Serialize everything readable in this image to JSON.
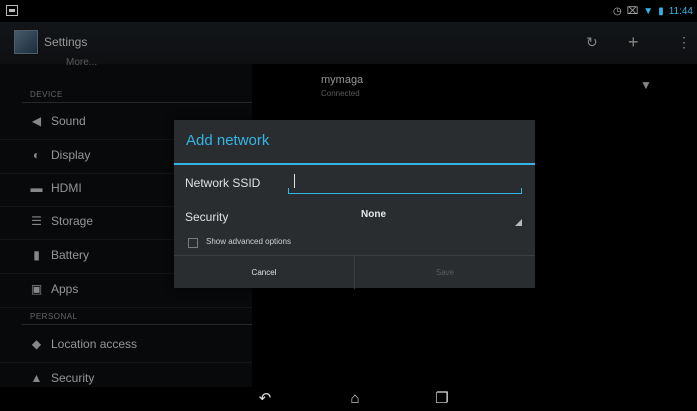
{
  "status_bar": {
    "time": "11:44"
  },
  "action_bar": {
    "title": "Settings"
  },
  "sidebar": {
    "partial_item": "More...",
    "device_header": "DEVICE",
    "personal_header": "PERSONAL",
    "items": [
      {
        "label": "Sound",
        "icon": "speaker-icon"
      },
      {
        "label": "Display",
        "icon": "brightness-icon"
      },
      {
        "label": "HDMI",
        "icon": "monitor-icon"
      },
      {
        "label": "Storage",
        "icon": "storage-icon"
      },
      {
        "label": "Battery",
        "icon": "battery-icon"
      },
      {
        "label": "Apps",
        "icon": "apps-icon"
      },
      {
        "label": "Location access",
        "icon": "location-icon"
      },
      {
        "label": "Security",
        "icon": "lock-icon"
      }
    ]
  },
  "wifi_list": {
    "ssid": "mymaga",
    "state": "Connected"
  },
  "dialog": {
    "title": "Add network",
    "ssid_label": "Network SSID",
    "ssid_value": "",
    "security_label": "Security",
    "security_value": "None",
    "advanced_label": "Show advanced options",
    "cancel_label": "Cancel",
    "save_label": "Save"
  },
  "colors": {
    "accent": "#33b5e5",
    "dialog_bg": "#2a2d30"
  }
}
